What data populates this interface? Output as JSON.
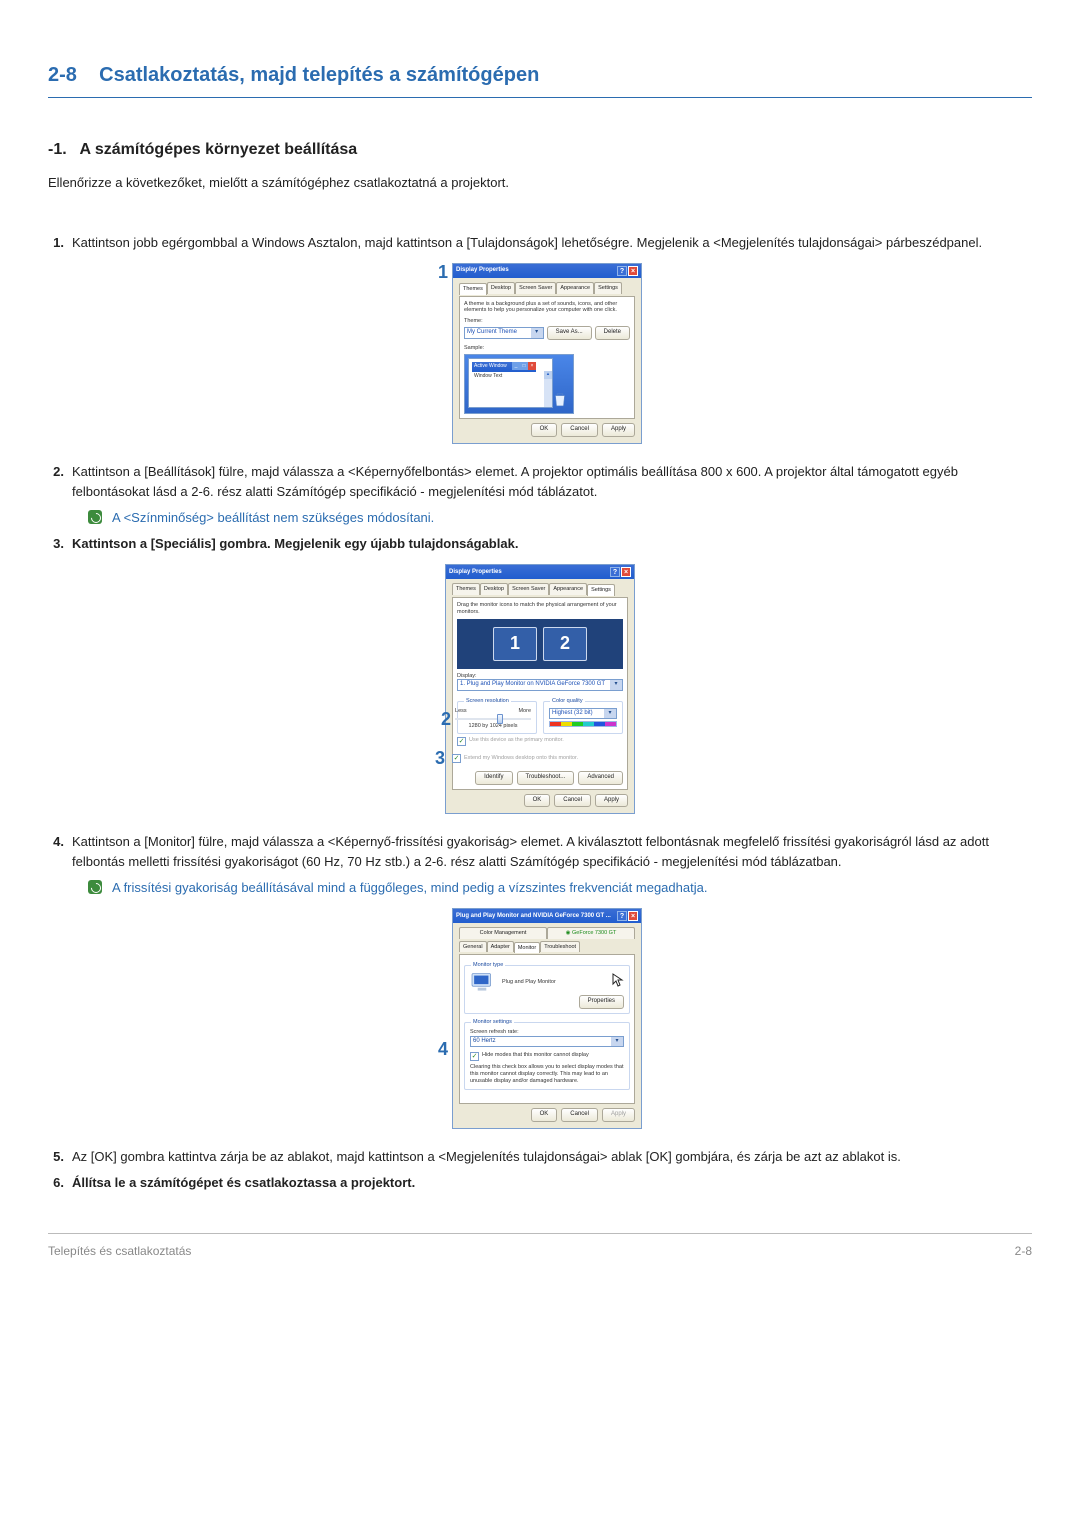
{
  "header": {
    "section_no": "2-8",
    "section_title": "Csatlakoztatás, majd telepítés a számítógépen"
  },
  "subsection": {
    "num": "-1.",
    "title": "A számítógépes környezet beállítása"
  },
  "intro": "Ellenőrizze a következőket, mielőtt a számítógéphez csatlakoztatná a projektort.",
  "steps": [
    {
      "n": "1.",
      "text": "Kattintson jobb egérgombbal a Windows Asztalon, majd kattintson a [Tulajdonságok] lehetőségre. Megjelenik a <Megjelenítés tulajdonságai> párbeszédpanel."
    },
    {
      "n": "2.",
      "text": "Kattintson a [Beállítások] fülre, majd válassza a <Képernyőfelbontás> elemet. A projektor optimális beállítása 800 x 600. A projektor által támogatott egyéb felbontásokat lásd a 2-6. rész alatti Számítógép specifikáció - megjelenítési mód táblázatot."
    },
    {
      "note1": "A <Színminőség> beállítást nem szükséges módosítani."
    },
    {
      "n": "3.",
      "text": "Kattintson a [Speciális] gombra. Megjelenik egy újabb tulajdonságablak.",
      "bold": true
    },
    {
      "n": "4.",
      "text": "Kattintson a [Monitor] fülre, majd válassza a <Képernyő-frissítési gyakoriság> elemet. A kiválasztott felbontásnak megfelelő frissítési gyakoriságról lásd az adott felbontás melletti frissítési gyakoriságot (60 Hz, 70 Hz stb.) a 2-6. rész alatti Számítógép specifikáció - megjelenítési mód táblázatban."
    },
    {
      "note2": "A frissítési gyakoriság beállításával mind a függőleges, mind pedig a vízszintes frekvenciát megadhatja."
    },
    {
      "n": "5.",
      "text": "Az [OK] gombra kattintva zárja be az ablakot, majd kattintson a <Megjelenítés tulajdonságai> ablak [OK] gombjára, és zárja be azt az ablakot is."
    },
    {
      "n": "6.",
      "text": "Állítsa le a számítógépet és csatlakoztassa a projektort.",
      "bold": true
    }
  ],
  "callouts": {
    "one": "1",
    "two": "2",
    "three": "3",
    "four": "4"
  },
  "dlg1": {
    "title": "Display Properties",
    "tabs": [
      "Themes",
      "Desktop",
      "Screen Saver",
      "Appearance",
      "Settings"
    ],
    "activeTab": "Themes",
    "desc": "A theme is a background plus a set of sounds, icons, and other elements to help you personalize your computer with one click.",
    "theme_label": "Theme:",
    "theme_value": "My Current Theme",
    "save_as": "Save As...",
    "delete": "Delete",
    "sample_label": "Sample:",
    "active_window": "Active Window",
    "window_text": "Window Text",
    "ok": "OK",
    "cancel": "Cancel",
    "apply": "Apply"
  },
  "dlg2": {
    "title": "Display Properties",
    "tabs": [
      "Themes",
      "Desktop",
      "Screen Saver",
      "Appearance",
      "Settings"
    ],
    "activeTab": "Settings",
    "drag_text": "Drag the monitor icons to match the physical arrangement of your monitors.",
    "mon1": "1",
    "mon2": "2",
    "display_label": "Display:",
    "display_value": "1. Plug and Play Monitor on NVIDIA GeForce 7300 GT",
    "res_title": "Screen resolution",
    "less": "Less",
    "more": "More",
    "res_value": "1280 by 1024 pixels",
    "cq_title": "Color quality",
    "cq_value": "Highest (32 bit)",
    "use_primary": "Use this device as the primary monitor.",
    "extend": "Extend my Windows desktop onto this monitor.",
    "identify": "Identify",
    "troubleshoot": "Troubleshoot...",
    "advanced": "Advanced",
    "ok": "OK",
    "cancel": "Cancel",
    "apply": "Apply"
  },
  "dlg3": {
    "title": "Plug and Play Monitor and NVIDIA GeForce 7300 GT ...",
    "tab_color": "Color Management",
    "tab_gf": "GeForce 7300 GT",
    "tab_general": "General",
    "tab_adapter": "Adapter",
    "tab_monitor": "Monitor",
    "tab_ts": "Troubleshoot",
    "mt_title": "Monitor type",
    "mt_value": "Plug and Play Monitor",
    "properties": "Properties",
    "ms_title": "Monitor settings",
    "refresh_label": "Screen refresh rate:",
    "refresh_value": "60 Hertz",
    "hide": "Hide modes that this monitor cannot display",
    "hide_desc": "Clearing this check box allows you to select display modes that this monitor cannot display correctly. This may lead to an unusable display and/or damaged hardware.",
    "ok": "OK",
    "cancel": "Cancel",
    "apply": "Apply"
  },
  "footer": {
    "left": "Telepítés és csatlakoztatás",
    "right": "2-8"
  }
}
